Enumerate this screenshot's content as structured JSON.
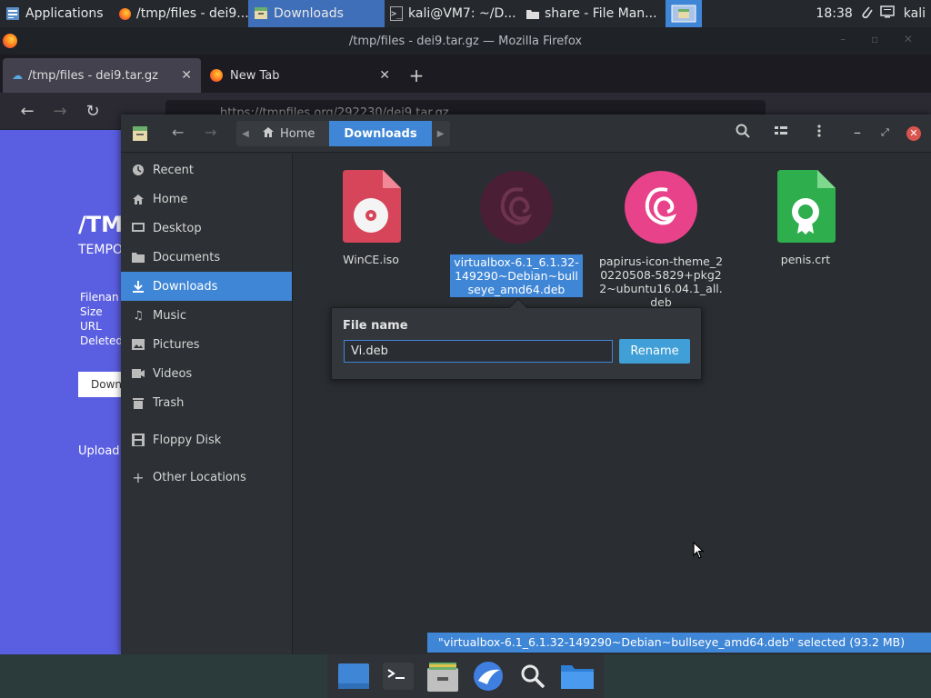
{
  "topbar": {
    "applications": "Applications",
    "task_firefox": "/tmp/files - dei9...",
    "task_downloads": "Downloads",
    "task_terminal": "kali@VM7: ~/D...",
    "task_share": "share - File Man...",
    "clock": "18:38",
    "user": "kali"
  },
  "firefox": {
    "window_title": "/tmp/files - dei9.tar.gz — Mozilla Firefox",
    "tabs": [
      {
        "label": "/tmp/files - dei9.tar.gz"
      },
      {
        "label": "New Tab"
      }
    ],
    "url": "https://tmpfiles.org/292230/dei9.tar.gz",
    "page": {
      "title": "/TM",
      "subtitle": "TEMPO",
      "labels": [
        "Filenan",
        "Size",
        "URL",
        "Deleted"
      ],
      "download_button": "Down",
      "upload": "Upload"
    }
  },
  "file_manager": {
    "breadcrumbs": [
      {
        "label": "Home"
      },
      {
        "label": "Downloads"
      }
    ],
    "sidebar": {
      "items": [
        {
          "label": "Recent",
          "icon": "clock-icon"
        },
        {
          "label": "Home",
          "icon": "home-icon"
        },
        {
          "label": "Desktop",
          "icon": "desktop-icon"
        },
        {
          "label": "Documents",
          "icon": "documents-icon"
        },
        {
          "label": "Downloads",
          "icon": "download-icon"
        },
        {
          "label": "Music",
          "icon": "music-icon"
        },
        {
          "label": "Pictures",
          "icon": "pictures-icon"
        },
        {
          "label": "Videos",
          "icon": "videos-icon"
        },
        {
          "label": "Trash",
          "icon": "trash-icon"
        },
        {
          "label": "Floppy Disk",
          "icon": "floppy-icon"
        },
        {
          "label": "Other Locations",
          "icon": "plus-icon"
        }
      ]
    },
    "files": [
      {
        "name": "WinCE.iso"
      },
      {
        "name": "virtualbox-6.1_6.1.32-149290~Debian~bullseye_amd64.deb"
      },
      {
        "name": "papirus-icon-theme_20220508-5829+pkg22~ubuntu16.04.1_all.deb"
      },
      {
        "name": "penis.crt"
      }
    ],
    "rename_popover": {
      "label": "File name",
      "value": "Vi.deb",
      "button": "Rename"
    },
    "status": "\"virtualbox-6.1_6.1.32-149290~Debian~bullseye_amd64.deb\" selected  (93.2 MB)"
  },
  "colors": {
    "accent": "#3f86d6",
    "page_bg": "#5a5ee0",
    "rename_button": "#3f9fd6"
  }
}
